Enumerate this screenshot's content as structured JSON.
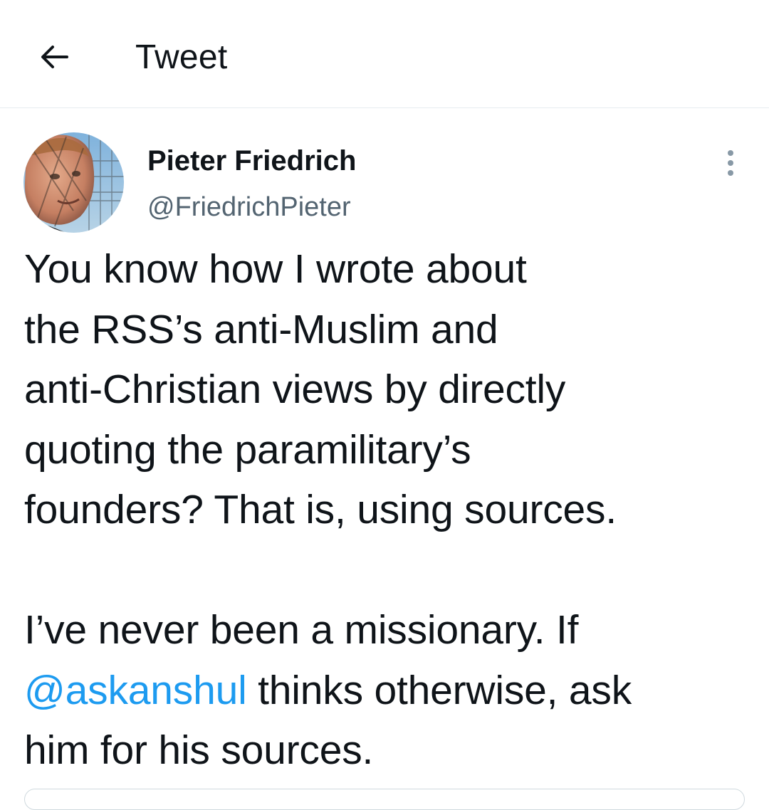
{
  "header": {
    "back_icon": "arrow-left-icon",
    "title": "Tweet"
  },
  "author": {
    "display_name": "Pieter Friedrich",
    "handle": "@FriedrichPieter",
    "avatar_icon": "avatar"
  },
  "menu_icon": "more-vertical-icon",
  "tweet": {
    "paragraph1": {
      "line1": "You know how I wrote about",
      "line2": "the RSS’s anti-Muslim and",
      "line3": "anti-Christian views by directly",
      "line4": "quoting the paramilitary’s",
      "line5": "founders? That is, using sources."
    },
    "paragraph2": {
      "line1": "I’ve never been a missionary. If",
      "mention": "@askanshul",
      "line2_rest": " thinks otherwise, ask",
      "line3": "him for his sources."
    }
  },
  "colors": {
    "mention": "#1d9bf0",
    "secondary_text": "#536471",
    "divider": "#e6ecf0"
  }
}
